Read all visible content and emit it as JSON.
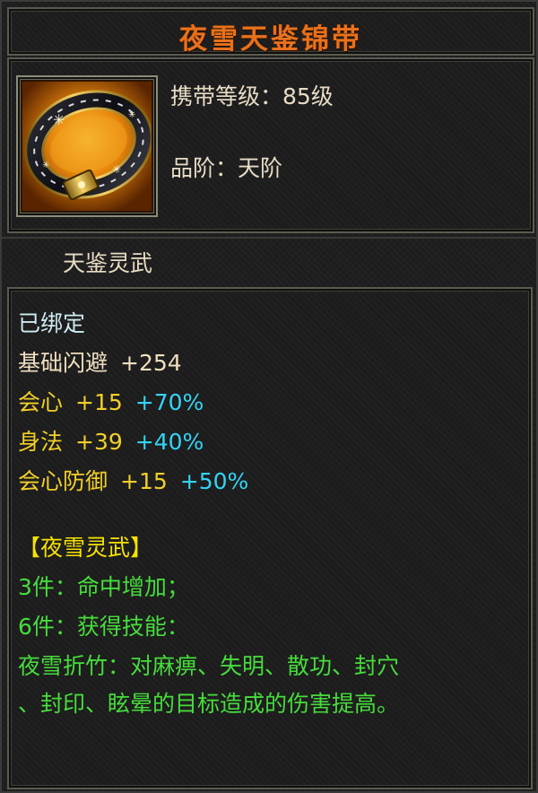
{
  "item": {
    "name": "夜雪天鉴锦带",
    "carry_level": "携带等级：85级",
    "grade": "品阶：天阶",
    "subtitle": "天鉴灵武",
    "bound": "已绑定",
    "stats": [
      {
        "name": "基础闪避",
        "value": "+254",
        "bonus": ""
      },
      {
        "name": "会心",
        "value": "+15",
        "bonus": "+70%"
      },
      {
        "name": "身法",
        "value": "+39",
        "bonus": "+40%"
      },
      {
        "name": "会心防御",
        "value": "+15",
        "bonus": "+50%"
      }
    ],
    "set": {
      "title": "【夜雪灵武】",
      "bonus3": "3件：命中增加；",
      "bonus6": "6件：获得技能：",
      "skill_line1": "夜雪折竹：对麻痹、失明、散功、封穴",
      "skill_line2": "、封印、眩晕的目标造成的伤害提高。"
    },
    "icon": "belt-icon"
  },
  "colors": {
    "title": "#e8711d",
    "base_text": "#e6dcc5",
    "bound": "#cfeaf2",
    "stat_yellow": "#f1cf2a",
    "bonus_cyan": "#33d4f5",
    "set_green": "#46dc3c",
    "set_title": "#f6e200"
  }
}
